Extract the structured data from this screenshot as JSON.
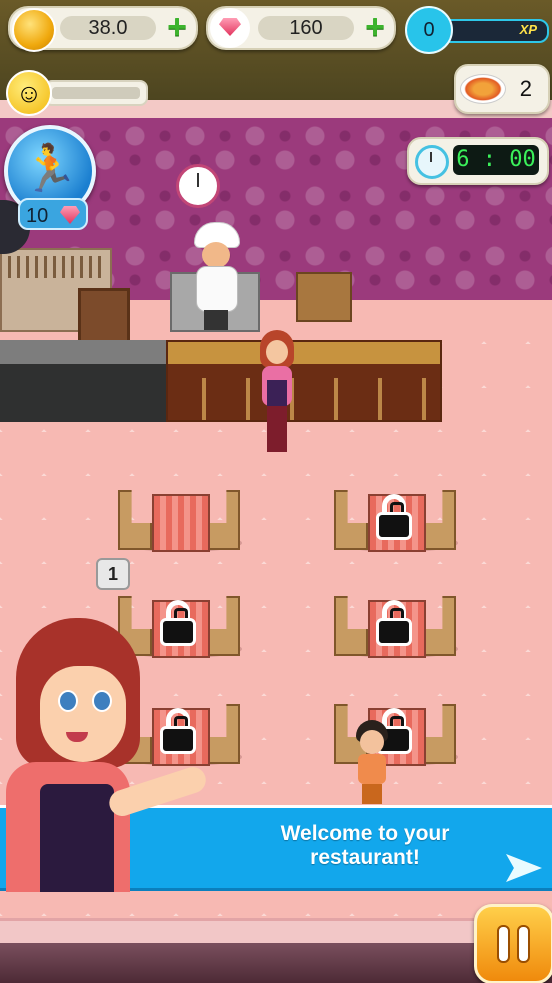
{
  "hud": {
    "coins": "38.0",
    "gems": "160",
    "xp_level": "0",
    "xp_label": "XP",
    "orders_count": "2",
    "timer": "6 : 00",
    "boost_cost": "10"
  },
  "tables": {
    "badge": "1"
  },
  "tutorial": {
    "message": "Welcome to your\nrestaurant!"
  },
  "icons": {
    "coin": "coin-icon",
    "gem": "gem-icon",
    "add": "plus-icon",
    "happiness": "smiley-icon",
    "food": "pizza-icon",
    "clock": "clock-icon",
    "boost": "running-man-icon",
    "lock": "lock-icon",
    "next": "arrow-right-icon",
    "pause": "pause-icon"
  },
  "colors": {
    "accent": "#12a7ec",
    "add": "#3cb42d",
    "pause": "#f5a623",
    "timer_text": "#3bf05a"
  }
}
